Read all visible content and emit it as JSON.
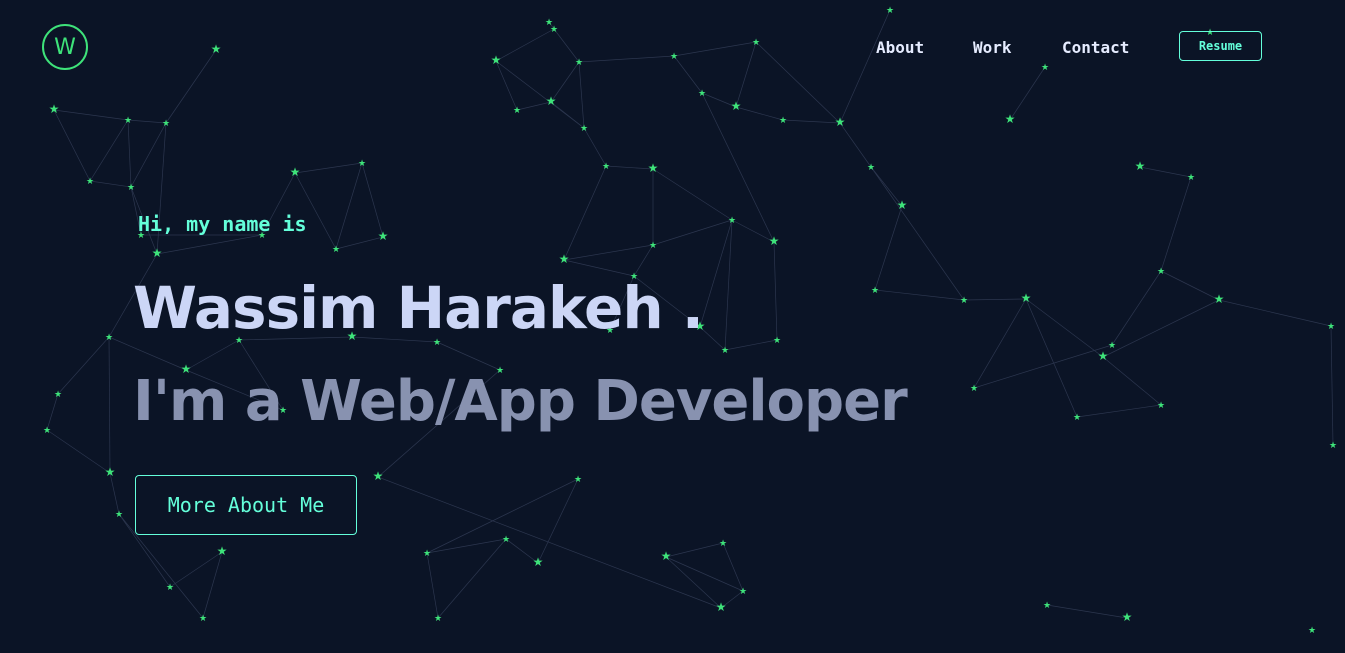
{
  "brand": {
    "logo_letter": "W",
    "accent_color": "#3ee37a"
  },
  "nav": {
    "items": [
      {
        "label": "About"
      },
      {
        "label": "Work"
      },
      {
        "label": "Contact"
      }
    ],
    "resume_label": "Resume"
  },
  "hero": {
    "greeting": "Hi, my name is",
    "name": "Wassim Harakeh .",
    "tagline": "I'm a Web/App Developer",
    "cta_label": "More About Me"
  },
  "theme": {
    "background": "#0b1426",
    "primary_text": "#ccd6f6",
    "secondary_text": "#8892b0",
    "highlight": "#64ffda",
    "star_color": "#3ee37a"
  }
}
